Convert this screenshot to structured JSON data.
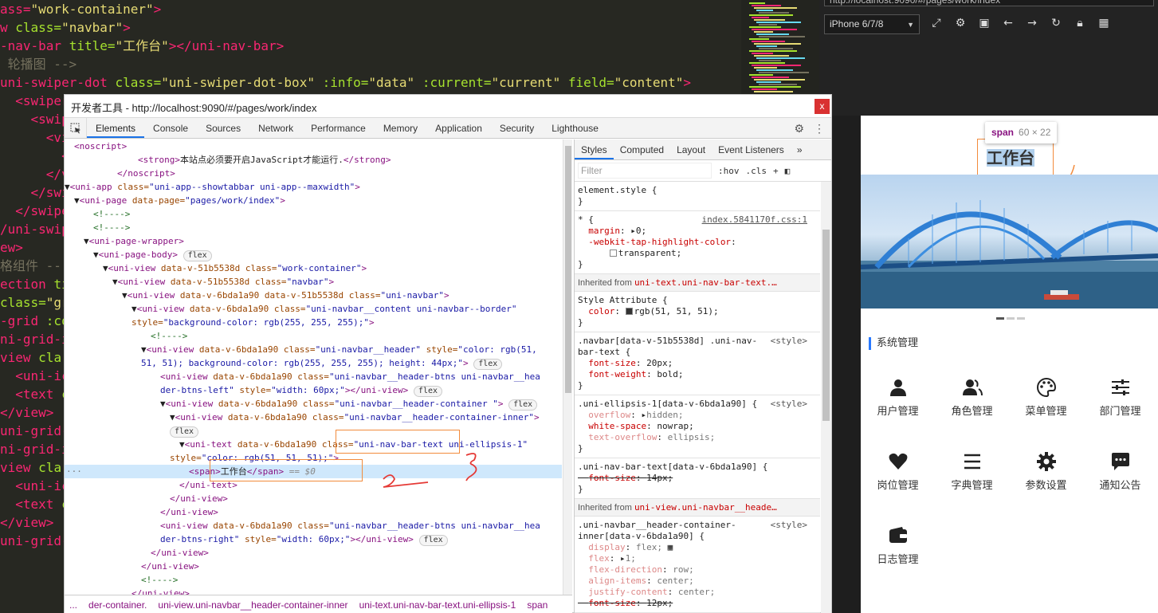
{
  "editor": {
    "lines": [
      [
        "t:ass=",
        "s:\"work-container\"",
        "t:>"
      ],
      [
        "t:w ",
        "a:class=",
        "s:\"navbar\"",
        "t:>"
      ],
      [
        "t:-nav-bar ",
        "a:title=",
        "s:\"工作台\"",
        "t:></uni-nav-bar>"
      ],
      [
        "c: 轮播图 -->"
      ],
      [
        "t:uni-swiper-dot ",
        "a:class=",
        "s:\"uni-swiper-dot-box\" ",
        "a::info=",
        "s:\"data\" ",
        "a::current=",
        "s:\"current\" ",
        "a:field=",
        "s:\"content\"",
        "t:>"
      ],
      [
        "t:  <swiper"
      ],
      [
        "t:    <swip"
      ],
      [
        "t:      <vi"
      ],
      [
        "t:        <"
      ],
      [
        "t:      </vi"
      ],
      [
        "t:    </swi"
      ],
      [
        "t:  </swipe"
      ],
      [
        "t:/uni-swipe"
      ],
      [
        "t:ew>"
      ],
      [
        "c:格组件 --"
      ],
      [
        "t:ection ",
        "a:ti"
      ],
      [
        "a:class=",
        "s:\"gr"
      ],
      [
        "t:-grid ",
        "a::co"
      ],
      [
        "t:ni-grid-i"
      ],
      [
        "t:view ",
        "a:cla"
      ],
      [
        "t:  <uni-ic"
      ],
      [
        "t:  <text ",
        "a:c"
      ],
      [
        "t:</view>"
      ],
      [
        "t:uni-grid-"
      ],
      [
        "t:ni-grid-i"
      ],
      [
        "t:view ",
        "a:cla"
      ],
      [
        "t:  <uni-ic"
      ],
      [
        "t:  <text ",
        "a:c"
      ],
      [
        "t:</view>"
      ],
      [
        "t:uni-grid-"
      ]
    ]
  },
  "browser": {
    "url": "http://localhost:9090/#/pages/work/index",
    "device": "iPhone 6/7/8"
  },
  "phone": {
    "nav_title": "工作台",
    "tooltip_tag": "span",
    "tooltip_size": "60 × 22",
    "section_title": "系统管理",
    "grid": [
      {
        "label": "用户管理",
        "icon": "person-icon"
      },
      {
        "label": "角色管理",
        "icon": "people-icon"
      },
      {
        "label": "菜单管理",
        "icon": "palette-icon"
      },
      {
        "label": "部门管理",
        "icon": "sliders-icon"
      },
      {
        "label": "岗位管理",
        "icon": "heart-icon"
      },
      {
        "label": "字典管理",
        "icon": "list-icon"
      },
      {
        "label": "参数设置",
        "icon": "gear-icon"
      },
      {
        "label": "通知公告",
        "icon": "chat-icon"
      },
      {
        "label": "日志管理",
        "icon": "wallet-icon"
      }
    ]
  },
  "devtools": {
    "title": "开发者工具 - http://localhost:9090/#/pages/work/index",
    "close": "x",
    "tabs": [
      "Elements",
      "Console",
      "Sources",
      "Network",
      "Performance",
      "Memory",
      "Application",
      "Security",
      "Lighthouse"
    ],
    "active_tab": "Elements",
    "breadcrumbs": [
      "...",
      "der-container.",
      "uni-view.uni-navbar__header-container-inner",
      "uni-text.uni-nav-bar-text.uni-ellipsis-1",
      "span"
    ],
    "styles_tabs": [
      "Styles",
      "Computed",
      "Layout",
      "Event Listeners",
      "»"
    ],
    "filter_placeholder": "Filter",
    "filter_hov": ":hov",
    "filter_cls": ".cls",
    "filter_plus": "+",
    "element_style": "element.style {",
    "star_selector": "* {",
    "star_source": "index.5841170f.css:1",
    "margin_prop": "margin",
    "margin_val": "0;",
    "tap_prop": "-webkit-tap-highlight-color",
    "tap_val": "transparent;",
    "inherited_1_label": "Inherited from",
    "inherited_1_sel": "uni-text.uni-nav-bar-text.…",
    "style_attr": "Style Attribute {",
    "color_prop": "color",
    "color_val": "rgb(51, 51, 51);",
    "rule_navbar_sel": ".navbar[data-v-51b5538d] .uni-nav-",
    "rule_navbar_sel2": "bar-text {",
    "style_src": "<style>",
    "font_size_prop": "font-size",
    "font_size_val": "20px;",
    "font_weight_prop": "font-weight",
    "font_weight_val": "bold;",
    "ellipsis_sel": ".uni-ellipsis-1[data-v-6bda1a90] {",
    "overflow_prop": "overflow",
    "overflow_val": "hidden;",
    "ws_prop": "white-space",
    "ws_val": "nowrap;",
    "to_prop": "text-overflow",
    "to_val": "ellipsis;",
    "navtext_sel": ".uni-nav-bar-text[data-v-6bda1a90] {",
    "navtext_fs_prop": "font-size",
    "navtext_fs_val": "14px;",
    "inherited_2_label": "Inherited from",
    "inherited_2_sel": "uni-view.uni-navbar__heade…",
    "inner_sel": ".uni-navbar__header-container-",
    "inner_sel2": "inner[data-v-6bda1a90] {",
    "display_prop": "display",
    "display_val": "flex;",
    "flex_prop": "flex",
    "flex_val": "1;",
    "fd_prop": "flex-direction",
    "fd_val": "row;",
    "ai_prop": "align-items",
    "ai_val": "center;",
    "jc_prop": "justify-content",
    "jc_val": "center;",
    "inner_fs_prop": "font-size",
    "inner_fs_val": "12px;"
  },
  "dom": {
    "lines": [
      {
        "i": 38,
        "h": "<t><noscript></t>"
      },
      {
        "i": 118,
        "h": "<t><strong></t>本站点必须要开启JavaScript才能运行.<t></strong></t>"
      },
      {
        "i": 92,
        "h": "<t></noscript></t>"
      },
      {
        "i": 26,
        "h": "▼<t><uni-app </t><a>class=</a><v>\"uni-app--showtabbar uni-app--maxwidth\"</v><t>></t>"
      },
      {
        "i": 38,
        "h": "▼<t><uni-page </t><a>data-page=</a><v>\"pages/work/index\"</v><t>></t>"
      },
      {
        "i": 62,
        "h": "<c><!----></c>"
      },
      {
        "i": 62,
        "h": "<c><!----></c>"
      },
      {
        "i": 50,
        "h": "▼<t><uni-page-wrapper></t>"
      },
      {
        "i": 62,
        "h": "▼<t><uni-page-body></t> <b>flex</b>"
      },
      {
        "i": 74,
        "h": "▼<t><uni-view </t><a>data-v-51b5538d class=</a><v>\"work-container\"</v><t>></t>"
      },
      {
        "i": 86,
        "h": "▼<t><uni-view </t><a>data-v-51b5538d class=</a><v>\"navbar\"</v><t>></t>"
      },
      {
        "i": 98,
        "h": "▼<t><uni-view </t><a>data-v-6bda1a90 data-v-51b5538d class=</a><v>\"uni-navbar\"</v><t>></t>"
      },
      {
        "i": 110,
        "h": "▼<t><uni-view </t><a>data-v-6bda1a90 class=</a><v>\"uni-navbar__content uni-navbar--border\"</v>"
      },
      {
        "i": 110,
        "h": "<a>style=</a><v>\"background-color: rgb(255, 255, 255);\"</v><t>></t>"
      },
      {
        "i": 134,
        "h": "<c><!----></c>"
      },
      {
        "i": 122,
        "h": "▼<t><uni-view </t><a>data-v-6bda1a90 class=</a><v>\"uni-navbar__header\"</v> <a>style=</a><v>\"color: rgb(51,</v>"
      },
      {
        "i": 122,
        "h": "<v>51, 51); background-color: rgb(255, 255, 255); height: 44px;\"</v><t>></t> <b>flex</b>"
      },
      {
        "i": 146,
        "h": "<t><uni-view </t><a>data-v-6bda1a90 class=</a><v>\"uni-navbar__header-btns uni-navbar__hea</v>"
      },
      {
        "i": 146,
        "h": "<v>der-btns-left\"</v> <a>style=</a><v>\"width: 60px;\"</v><t>></uni-view></t> <b>flex</b>"
      },
      {
        "i": 146,
        "h": "▼<t><uni-view </t><a>data-v-6bda1a90 class=</a><v>\"uni-navbar__header-container \"</v><t>></t> <b>flex</b>"
      },
      {
        "i": 158,
        "h": "▼<t><uni-view </t><a>data-v-6bda1a90 class=</a><v>\"uni-navbar__header-container-inner\"</v><t>></t>"
      },
      {
        "i": 158,
        "h": "<b>flex</b>"
      },
      {
        "i": 170,
        "h": "▼<t><uni-text </t><a>data-v-6bda1a90 class=</a><v>\"uni-nav-bar-text uni-ellipsis-1\"</v>"
      },
      {
        "i": 158,
        "h": "<a>style=</a><v>\"color: rgb(51, 51, 51);\"</v><t>></t>"
      },
      {
        "i": 182,
        "h": "<t><span></t>工作台<t></span></t> <e>== $0</e>",
        "sel": true
      },
      {
        "i": 170,
        "h": "<t></uni-text></t>"
      },
      {
        "i": 158,
        "h": "<t></uni-view></t>"
      },
      {
        "i": 146,
        "h": "<t></uni-view></t>"
      },
      {
        "i": 146,
        "h": "<t><uni-view </t><a>data-v-6bda1a90 class=</a><v>\"uni-navbar__header-btns uni-navbar__hea</v>"
      },
      {
        "i": 146,
        "h": "<v>der-btns-right\"</v> <a>style=</a><v>\"width: 60px;\"</v><t>></uni-view></t> <b>flex</b>"
      },
      {
        "i": 134,
        "h": "<t></uni-view></t>"
      },
      {
        "i": 122,
        "h": "<t></uni-view></t>"
      },
      {
        "i": 122,
        "h": "<c><!----></c>"
      },
      {
        "i": 110,
        "h": "<t></uni-view></t>"
      }
    ]
  },
  "colors": {
    "accent": "#1a73e8",
    "highlight_box": "#f28b3c",
    "annotation_red": "#e53935",
    "tag": "#881280",
    "section_bar": "#2979ff"
  }
}
